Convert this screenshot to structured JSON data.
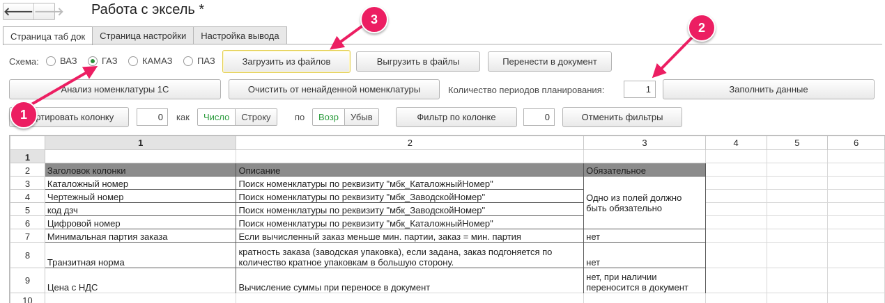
{
  "window": {
    "title": "Работа с эксель *",
    "back_glyph": "🡐",
    "forward_glyph": "🡒"
  },
  "tabs": [
    "Страница таб док",
    "Страница настройки",
    "Настройка вывода"
  ],
  "schema": {
    "label": "Схема:",
    "options": [
      "ВАЗ",
      "ГАЗ",
      "КАМАЗ",
      "ПАЗ"
    ],
    "selected": "ГАЗ"
  },
  "row1": {
    "load_files": "Загрузить из файлов",
    "export_files": "Выгрузить в файлы",
    "move_to_doc": "Перенести в документ"
  },
  "row2": {
    "analysis": "Анализ номенклатуры 1С",
    "clear_not_found": "Очистить от ненайденной номенклатуры",
    "periods_label": "Количество периодов планирования:",
    "periods_value": "1",
    "fill_data": "Заполнить данные"
  },
  "row3": {
    "sort_column": "Сортировать колонку",
    "sort_col_value": "0",
    "as_label": "как",
    "as_options": [
      "Число",
      "Строку"
    ],
    "by_label": "по",
    "order_options": [
      "Возр",
      "Убыв"
    ],
    "filter_by_column": "Фильтр по колонке",
    "filter_value": "0",
    "cancel_filters": "Отменить фильтры"
  },
  "sheet": {
    "columns": [
      "1",
      "2",
      "3",
      "4",
      "5",
      "6"
    ],
    "rows": [
      {
        "n": "1",
        "cells": [
          "",
          "",
          ""
        ]
      },
      {
        "n": "2",
        "cells": [
          "Заголовок колонки",
          "Описание",
          "Обязательное"
        ]
      },
      {
        "n": "3",
        "cells": [
          "Каталожный номер",
          "Поиск номенклатуры по реквизиту \"мбк_КаталожныйНомер\""
        ]
      },
      {
        "n": "4",
        "cells": [
          "Чертежный номер",
          "Поиск номенклатуры по реквизиту \"мбк_ЗаводскойНомер\""
        ]
      },
      {
        "n": "5",
        "cells": [
          "код дзч",
          "Поиск номенклатуры по реквизиту \"мбк_ЗаводскойНомер\""
        ]
      },
      {
        "n": "6",
        "cells": [
          "Цифровой номер",
          "Поиск номенклатуры по реквизиту \"мбк_КаталожныйНомер\""
        ]
      },
      {
        "n": "7",
        "cells": [
          "Минимальная партия заказа",
          "Если вычисленный заказ меньше мин. партии, заказ = мин. партия",
          "нет"
        ]
      },
      {
        "n": "8",
        "cells": [
          "Транзитная норма",
          "кратность заказа (заводская упаковка), если задана, заказ подгоняется по количество кратное упаковкам в большую сторону.",
          "нет"
        ]
      },
      {
        "n": "9",
        "cells": [
          "Цена с НДС",
          "Вычисление суммы при переносе в документ",
          "нет, при наличии переносится в документ"
        ]
      },
      {
        "n": "10",
        "cells": [
          "",
          "",
          ""
        ]
      }
    ],
    "merged_note": "Одно из полей должно быть обязательно"
  },
  "annotations": [
    "1",
    "2",
    "3"
  ],
  "colors": {
    "accent": "#ec1e62",
    "header_fill": "#8c8c8c",
    "selected_green": "#2a9b3c"
  }
}
